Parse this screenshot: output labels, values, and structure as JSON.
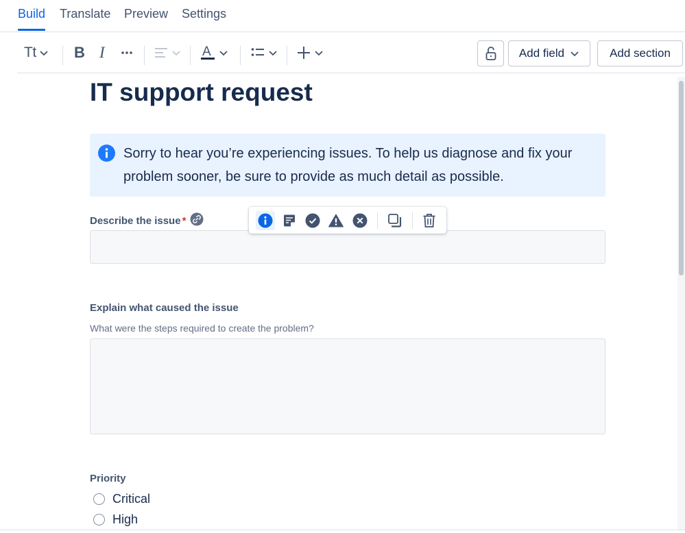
{
  "tabs": [
    {
      "label": "Build",
      "active": true
    },
    {
      "label": "Translate",
      "active": false
    },
    {
      "label": "Preview",
      "active": false
    },
    {
      "label": "Settings",
      "active": false
    }
  ],
  "toolbar": {
    "text_style_label": "Tt",
    "add_field_label": "Add field",
    "add_section_label": "Add section",
    "text_color": "#172b4d"
  },
  "form": {
    "title": "IT support request",
    "info_panel": {
      "text": "Sorry to hear you’re experiencing issues. To help us diagnose and fix your problem sooner, be sure to provide as much detail as possible.",
      "icon": "info-icon",
      "color": "#1d7afc"
    },
    "fields": [
      {
        "label": "Describe the issue",
        "required_mark": "*"
      },
      {
        "label": "Explain what caused the issue",
        "helper": "What were the steps required to create the problem?"
      }
    ],
    "priority": {
      "label": "Priority",
      "options": [
        "Critical",
        "High"
      ]
    }
  },
  "panel_toolbar": {
    "icons": [
      "info-icon",
      "note-icon",
      "success-icon",
      "warning-icon",
      "error-icon",
      "copy-icon",
      "delete-icon"
    ]
  }
}
